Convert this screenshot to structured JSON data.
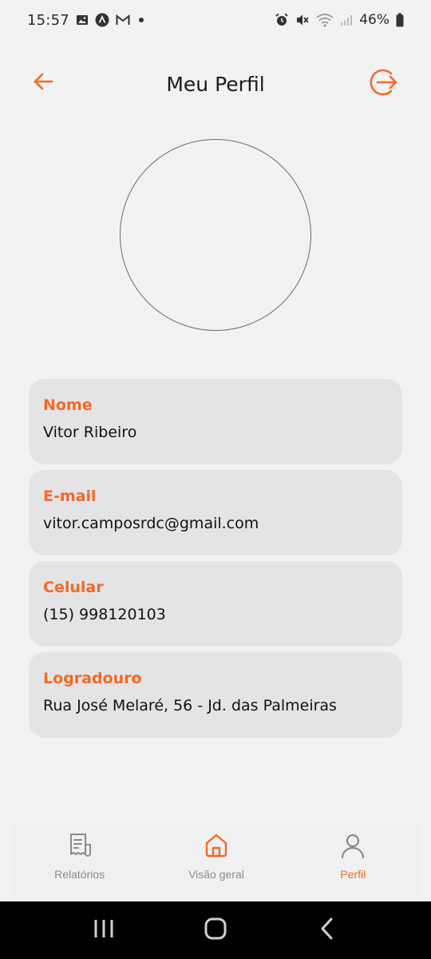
{
  "status_bar": {
    "time": "15:57",
    "battery": "46%",
    "left_icons": [
      "image-icon",
      "app-icon",
      "gmail-icon",
      "dot-icon"
    ],
    "right_icons": [
      "alarm-icon",
      "mute-icon",
      "wifi-icon",
      "signal-icon",
      "battery-icon"
    ]
  },
  "header": {
    "title": "Meu Perfil",
    "back_icon": "arrow-left-icon",
    "logout_icon": "logout-icon"
  },
  "profile": {
    "fields": [
      {
        "label": "Nome",
        "value": "Vitor Ribeiro"
      },
      {
        "label": "E-mail",
        "value": "vitor.camposrdc@gmail.com"
      },
      {
        "label": "Celular",
        "value": "(15) 998120103"
      },
      {
        "label": "Logradouro",
        "value": "Rua José Melaré, 56 - Jd. das Palmeiras"
      }
    ]
  },
  "bottom_nav": {
    "items": [
      {
        "label": "Relatórios",
        "icon": "receipt-icon",
        "active": false
      },
      {
        "label": "Visão geral",
        "icon": "home-icon",
        "active": false
      },
      {
        "label": "Perfil",
        "icon": "user-icon",
        "active": true
      }
    ]
  },
  "colors": {
    "accent": "#f26a24",
    "card_bg": "#e4e4e7",
    "background": "#f2f2f2"
  }
}
